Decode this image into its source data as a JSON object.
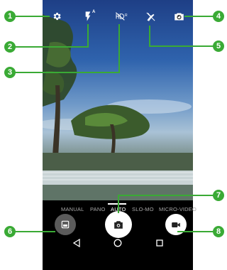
{
  "camera_modes": {
    "manual": "MANUAL",
    "pano": "PANO",
    "auto": "AUTO",
    "slo_mo": "SLO-MO",
    "micro_video": "MICRO-VIDEO",
    "selected": "AUTO"
  },
  "callouts": {
    "c1": "1",
    "c2": "2",
    "c3": "3",
    "c4": "4",
    "c5": "5",
    "c6": "6",
    "c7": "7",
    "c8": "8"
  },
  "flash_indicator": "A",
  "hdr_indicator": "R",
  "colors": {
    "callout_green": "#3aaa35",
    "screen_bg": "#000000",
    "mode_active": "#ffffff",
    "mode_inactive": "#a8a8a8"
  },
  "icons": {
    "settings": "gear-icon",
    "flash": "flash-auto-icon",
    "hdr": "hdr-off-icon",
    "scene": "scene-off-icon",
    "switch_camera": "switch-camera-icon",
    "gallery": "gallery-thumbnail-icon",
    "shutter": "camera-icon",
    "video": "video-camera-icon",
    "back": "back-triangle-icon",
    "home": "home-circle-icon",
    "recents": "recents-square-icon"
  }
}
